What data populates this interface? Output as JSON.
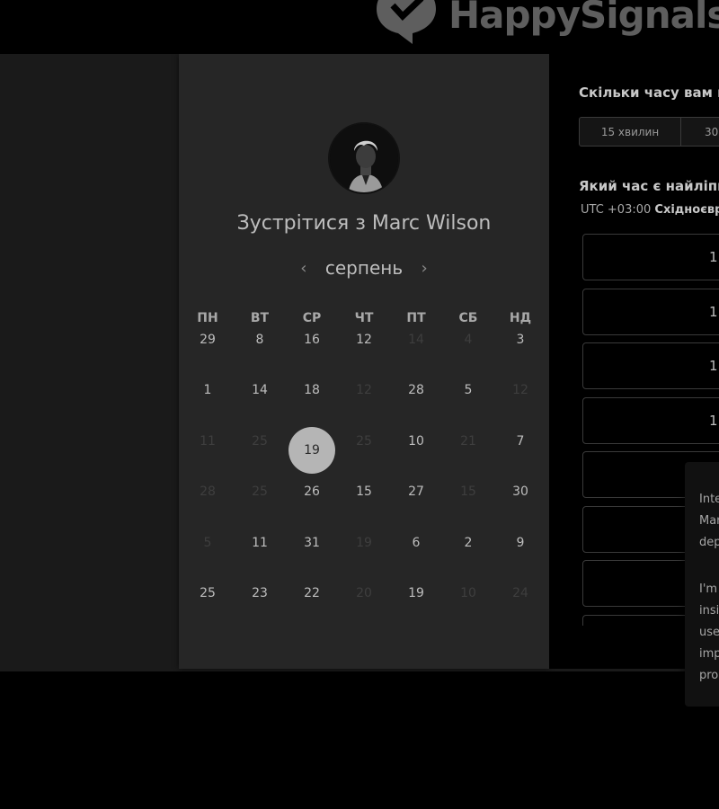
{
  "brand": {
    "name": "HappySignals"
  },
  "organizer": {
    "title": "Зустрітися з Marc Wilson",
    "avatar_icon": "person-avatar"
  },
  "calendar": {
    "month": "серпень",
    "prev_icon": "chevron-left-icon",
    "next_icon": "chevron-right-icon",
    "weekdays": [
      "ПН",
      "ВТ",
      "СР",
      "ЧТ",
      "ПТ",
      "СБ",
      "НД"
    ],
    "weeks": [
      [
        {
          "d": "29",
          "m": false
        },
        {
          "d": "8",
          "m": false
        },
        {
          "d": "16",
          "m": false
        },
        {
          "d": "12",
          "m": false
        },
        {
          "d": "14",
          "m": true
        },
        {
          "d": "4",
          "m": true
        },
        {
          "d": "3",
          "m": false
        }
      ],
      [
        {
          "d": "1",
          "m": false
        },
        {
          "d": "14",
          "m": false
        },
        {
          "d": "18",
          "m": false
        },
        {
          "d": "12",
          "m": true
        },
        {
          "d": "28",
          "m": false
        },
        {
          "d": "5",
          "m": false
        },
        {
          "d": "12",
          "m": true
        }
      ],
      [
        {
          "d": "11",
          "m": true
        },
        {
          "d": "25",
          "m": true
        },
        {
          "d": "19",
          "m": false,
          "sel": true
        },
        {
          "d": "25",
          "m": true
        },
        {
          "d": "10",
          "m": false
        },
        {
          "d": "21",
          "m": true
        },
        {
          "d": "7",
          "m": false
        }
      ],
      [
        {
          "d": "28",
          "m": true
        },
        {
          "d": "25",
          "m": true
        },
        {
          "d": "26",
          "m": false
        },
        {
          "d": "15",
          "m": false
        },
        {
          "d": "27",
          "m": false
        },
        {
          "d": "15",
          "m": true
        },
        {
          "d": "30",
          "m": false
        }
      ],
      [
        {
          "d": "5",
          "m": true
        },
        {
          "d": "11",
          "m": false
        },
        {
          "d": "31",
          "m": false
        },
        {
          "d": "19",
          "m": true
        },
        {
          "d": "6",
          "m": false
        },
        {
          "d": "2",
          "m": false
        },
        {
          "d": "9",
          "m": false
        }
      ],
      [
        {
          "d": "25",
          "m": false
        },
        {
          "d": "23",
          "m": false
        },
        {
          "d": "22",
          "m": false
        },
        {
          "d": "20",
          "m": true
        },
        {
          "d": "19",
          "m": false
        },
        {
          "d": "10",
          "m": true
        },
        {
          "d": "24",
          "m": true
        }
      ]
    ]
  },
  "booking": {
    "duration_question": "Скільки часу вам п",
    "durations": [
      "15 хвилин",
      "30"
    ],
    "time_question": "Який час є найліпш",
    "timezone_offset": "UTC +03:00",
    "timezone_name": "Східноєвр",
    "slots": [
      "1",
      "1",
      "1",
      "1",
      "",
      "",
      ""
    ]
  },
  "popover": {
    "lines": [
      "Inte",
      "Mar",
      "dep",
      "I'm",
      "insi",
      "use",
      "imp",
      "pro"
    ]
  }
}
